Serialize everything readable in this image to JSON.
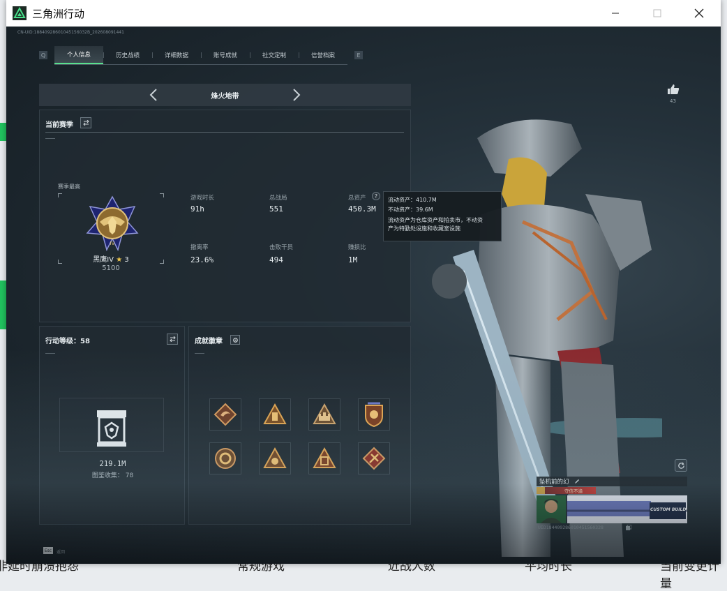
{
  "window": {
    "title": "三角洲行动",
    "controls": {
      "minimize": "minimize-icon",
      "maximize": "maximize-icon",
      "close": "close-icon"
    }
  },
  "background_fragments": [
    "非延时崩溃抱怨",
    "常规游戏",
    "近战人数",
    "平均时长",
    "当前变更计量"
  ],
  "game": {
    "uid_line": "CN-UID:18840928601045156032B_202608091441",
    "tabs": [
      "个人信息",
      "历史战绩",
      "详细数据",
      "账号成就",
      "社交定制",
      "信誉档案"
    ],
    "active_tab": "个人信息",
    "mode_title": "烽火地带",
    "like": {
      "icon": "thumbs-up-icon",
      "count": "43"
    },
    "season": {
      "header": "当前赛季",
      "best_label": "赛季最高",
      "rank_name": "黑鹰IV",
      "rank_star": "★",
      "rank_stars": "3",
      "rank_points": "5100",
      "stats": [
        {
          "label": "游戏时长",
          "value": "91h"
        },
        {
          "label": "总战局",
          "value": "551"
        },
        {
          "label": "总资产",
          "value": "450.3M"
        },
        {
          "label": "撤离率",
          "value": "23.6%"
        },
        {
          "label": "击败干员",
          "value": "494"
        },
        {
          "label": "赚损比",
          "value": "1M"
        }
      ]
    },
    "tooltip": {
      "liquid": "流动资产：410.7M",
      "fixed": "不动资产：39.6M",
      "desc_line1": "流动资产为仓库资产和拍卖市，不动资",
      "desc_line2": "产为特勤处设施和收藏室设施"
    },
    "level": {
      "header": "行动等级：58",
      "collection_value": "219.1M",
      "collection_label": "图鉴收集：",
      "collection_count": "78"
    },
    "badges": {
      "header": "成就徽章",
      "items": [
        "dragon-badge-icon",
        "tower-badge-icon",
        "castle-badge-icon",
        "crest-badge-icon",
        "ring-badge-icon",
        "emblem-badge-icon",
        "gate-badge-icon",
        "cross-badge-icon"
      ]
    },
    "player": {
      "name": "坠机前的幻",
      "tag": "守信不渝",
      "banner_text": "CUSTOM BUILD",
      "id_line": "UID184409286010451560328"
    },
    "footer_key": "Esc",
    "footer_label": "返回",
    "colors": {
      "accent": "#59e08d",
      "gold": "#c9a25a",
      "tag_red": "#c2312b"
    }
  }
}
